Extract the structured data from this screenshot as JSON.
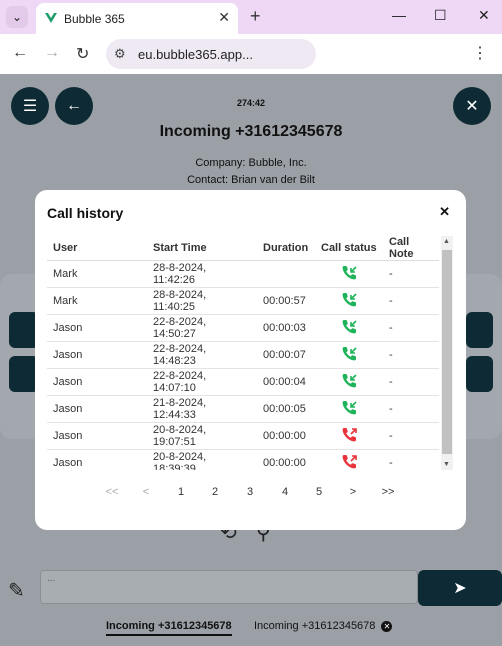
{
  "browser": {
    "tab_title": "Bubble 365",
    "url": "eu.bubble365.app..."
  },
  "app": {
    "timer": "274:42",
    "heading": "Incoming +31612345678",
    "company": "Company: Bubble, Inc.",
    "contact": "Contact: Brian van der Bilt",
    "message_placeholder": "...",
    "call_tabs": [
      {
        "label": "Incoming +31612345678",
        "active": true
      },
      {
        "label": "Incoming +31612345678",
        "active": false
      }
    ]
  },
  "modal": {
    "title": "Call history",
    "columns": [
      "User",
      "Start Time",
      "Duration",
      "Call status",
      "Call Note"
    ],
    "rows": [
      {
        "user": "Mark",
        "start": "28-8-2024, 11:42:26",
        "duration": "",
        "status": "answered",
        "note": "-"
      },
      {
        "user": "Mark",
        "start": "28-8-2024, 11:40:25",
        "duration": "00:00:57",
        "status": "answered",
        "note": "-"
      },
      {
        "user": "Jason",
        "start": "22-8-2024, 14:50:27",
        "duration": "00:00:03",
        "status": "answered",
        "note": "-"
      },
      {
        "user": "Jason",
        "start": "22-8-2024, 14:48:23",
        "duration": "00:00:07",
        "status": "answered",
        "note": "-"
      },
      {
        "user": "Jason",
        "start": "22-8-2024, 14:07:10",
        "duration": "00:00:04",
        "status": "answered",
        "note": "-"
      },
      {
        "user": "Jason",
        "start": "21-8-2024, 12:44:33",
        "duration": "00:00:05",
        "status": "answered",
        "note": "-"
      },
      {
        "user": "Jason",
        "start": "20-8-2024, 19:07:51",
        "duration": "00:00:00",
        "status": "missed",
        "note": "-"
      },
      {
        "user": "Jason",
        "start": "20-8-2024, 18:39:39",
        "duration": "00:00:00",
        "status": "missed",
        "note": "-"
      }
    ],
    "pagination": {
      "first": "<<",
      "prev": "<",
      "pages": [
        "1",
        "2",
        "3",
        "4",
        "5"
      ],
      "next": ">",
      "last": ">>"
    }
  },
  "colors": {
    "answered": "#1fb45a",
    "missed": "#e8343a",
    "dark": "#0e2a35"
  }
}
